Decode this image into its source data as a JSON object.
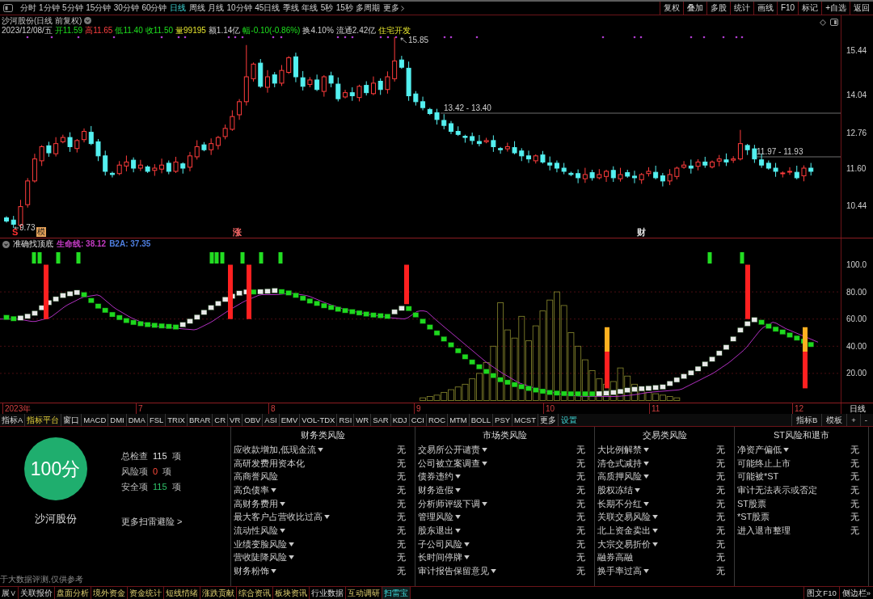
{
  "toolbar": {
    "periods": [
      {
        "label": "分时",
        "selected": false
      },
      {
        "label": "1分钟",
        "selected": false
      },
      {
        "label": "5分钟",
        "selected": false
      },
      {
        "label": "15分钟",
        "selected": false
      },
      {
        "label": "30分钟",
        "selected": false
      },
      {
        "label": "60分钟",
        "selected": false
      },
      {
        "label": "日线",
        "selected": true
      },
      {
        "label": "周线",
        "selected": false
      },
      {
        "label": "月线",
        "selected": false
      },
      {
        "label": "10分钟",
        "selected": false
      },
      {
        "label": "45日线",
        "selected": false
      },
      {
        "label": "季线",
        "selected": false
      },
      {
        "label": "年线",
        "selected": false
      },
      {
        "label": "5秒",
        "selected": false
      },
      {
        "label": "15秒",
        "selected": false
      },
      {
        "label": "多周期",
        "selected": false
      }
    ],
    "more": "更多",
    "actions": [
      "复权",
      "叠加",
      "多股",
      "统计",
      "画线",
      "F10",
      "标记",
      "+自选",
      "返回"
    ]
  },
  "stock_header": {
    "title": "沙河股份(日线 前复权)",
    "date": "2023/12/08/五",
    "quote": [
      {
        "text": "开11.59",
        "kind": "down"
      },
      {
        "text": "高11.65",
        "kind": "up"
      },
      {
        "text": "低11.40",
        "kind": "down"
      },
      {
        "text": "收11.50",
        "kind": "down"
      },
      {
        "text": "量99195",
        "kind": "volume"
      },
      {
        "text": "额1.14亿",
        "kind": "plain"
      },
      {
        "text": "幅-0.10(-0.86%)",
        "kind": "down"
      },
      {
        "text": "换4.10%",
        "kind": "plain"
      },
      {
        "text": "流通2.42亿",
        "kind": "plain"
      },
      {
        "text": "住宅开发",
        "kind": "sector"
      }
    ]
  },
  "price_chart": {
    "y_ticks": [
      "15.44",
      "14.04",
      "12.76",
      "11.60",
      "10.44"
    ],
    "high_label": "15.85",
    "low_label": "9.73",
    "price_lines": [
      {
        "label": "13.42 - 13.40"
      },
      {
        "label": "11.97 - 11.93"
      }
    ],
    "markers": [
      {
        "label": "S",
        "kind": "text",
        "color": "#ff3030"
      },
      {
        "label": "模",
        "kind": "tile",
        "color": "#e8a45a"
      },
      {
        "label": "涨",
        "kind": "text",
        "color": "#ff6a6a"
      },
      {
        "label": "财",
        "kind": "text",
        "color": "#e0e0e0"
      }
    ]
  },
  "indicator": {
    "name": "准确找顶底",
    "lines": [
      {
        "text": "生命线: 38.12",
        "color": "#c23bc2"
      },
      {
        "text": "B2A: 37.35",
        "color": "#4f7fe0"
      }
    ],
    "y_ticks": [
      "100.0",
      "80.00",
      "60.00",
      "40.00",
      "20.00"
    ]
  },
  "date_axis": {
    "labels": [
      "2023年",
      "7",
      "8",
      "9",
      "10",
      "11",
      "12"
    ],
    "period": "日线"
  },
  "indicator_tabs": {
    "items": [
      {
        "label": "指标A",
        "selected": false
      },
      {
        "label": "指标平台",
        "selected": true
      },
      {
        "label": "窗口",
        "selected": false
      },
      {
        "label": "MACD",
        "selected": false
      },
      {
        "label": "DMI",
        "selected": false
      },
      {
        "label": "DMA",
        "selected": false
      },
      {
        "label": "FSL",
        "selected": false
      },
      {
        "label": "TRIX",
        "selected": false
      },
      {
        "label": "BRAR",
        "selected": false
      },
      {
        "label": "CR",
        "selected": false
      },
      {
        "label": "VR",
        "selected": false
      },
      {
        "label": "OBV",
        "selected": false
      },
      {
        "label": "ASI",
        "selected": false
      },
      {
        "label": "EMV",
        "selected": false
      },
      {
        "label": "VOL-TDX",
        "selected": false
      },
      {
        "label": "RSI",
        "selected": false
      },
      {
        "label": "WR",
        "selected": false
      },
      {
        "label": "SAR",
        "selected": false
      },
      {
        "label": "KDJ",
        "selected": false
      },
      {
        "label": "CCI",
        "selected": false
      },
      {
        "label": "ROC",
        "selected": false
      },
      {
        "label": "MTM",
        "selected": false
      },
      {
        "label": "BOLL",
        "selected": false
      },
      {
        "label": "PSY",
        "selected": false
      },
      {
        "label": "MCST",
        "selected": false
      },
      {
        "label": "更多",
        "selected": false
      }
    ],
    "settings": "设置",
    "right": [
      "指标B",
      "模板",
      "+",
      "-"
    ]
  },
  "risk_scan": {
    "score": "100分",
    "stock": "沙河股份",
    "stats": [
      {
        "label": "总检查",
        "value": "115",
        "unit": "项",
        "kind": "total"
      },
      {
        "label": "风险项",
        "value": "0",
        "unit": "项",
        "kind": "risk"
      },
      {
        "label": "安全项",
        "value": "115",
        "unit": "项",
        "kind": "safe"
      }
    ],
    "more_link": "更多扫雷避险 >",
    "disclaimer": "于大数据评测,仅供参考",
    "categories": [
      {
        "title": "财务类风险",
        "items": [
          {
            "label": "应收款增加,低现金流",
            "dropdown": true,
            "result": "无"
          },
          {
            "label": "高研发费用资本化",
            "dropdown": false,
            "result": "无"
          },
          {
            "label": "高商誉风险",
            "dropdown": false,
            "result": "无"
          },
          {
            "label": "高负债率",
            "dropdown": true,
            "result": "无"
          },
          {
            "label": "高财务费用",
            "dropdown": true,
            "result": "无"
          },
          {
            "label": "最大客户占营收比过高",
            "dropdown": true,
            "result": "无"
          },
          {
            "label": "流动性风险",
            "dropdown": true,
            "result": "无"
          },
          {
            "label": "业绩变脸风险",
            "dropdown": true,
            "result": "无"
          },
          {
            "label": "营收陡降风险",
            "dropdown": true,
            "result": "无"
          },
          {
            "label": "财务粉饰",
            "dropdown": true,
            "result": "无"
          }
        ]
      },
      {
        "title": "市场类风险",
        "items": [
          {
            "label": "交易所公开谴责",
            "dropdown": true,
            "result": "无"
          },
          {
            "label": "公司被立案调查",
            "dropdown": true,
            "result": "无"
          },
          {
            "label": "债券违约",
            "dropdown": true,
            "result": "无"
          },
          {
            "label": "财务造假",
            "dropdown": true,
            "result": "无"
          },
          {
            "label": "分析师评级下调",
            "dropdown": true,
            "result": "无"
          },
          {
            "label": "管理风险",
            "dropdown": true,
            "result": "无"
          },
          {
            "label": "股东退出",
            "dropdown": true,
            "result": "无"
          },
          {
            "label": "子公司风险",
            "dropdown": true,
            "result": "无"
          },
          {
            "label": "长时间停牌",
            "dropdown": true,
            "result": "无"
          },
          {
            "label": "审计报告保留意见",
            "dropdown": true,
            "result": "无"
          }
        ]
      },
      {
        "title": "交易类风险",
        "items": [
          {
            "label": "大比例解禁",
            "dropdown": true,
            "result": "无"
          },
          {
            "label": "清仓式减持",
            "dropdown": true,
            "result": "无"
          },
          {
            "label": "高质押风险",
            "dropdown": true,
            "result": "无"
          },
          {
            "label": "股权冻结",
            "dropdown": true,
            "result": "无"
          },
          {
            "label": "长期不分红",
            "dropdown": true,
            "result": "无"
          },
          {
            "label": "关联交易风险",
            "dropdown": true,
            "result": "无"
          },
          {
            "label": "北上资金卖出",
            "dropdown": true,
            "result": "无"
          },
          {
            "label": "大宗交易折价",
            "dropdown": true,
            "result": "无"
          },
          {
            "label": "融券高融",
            "dropdown": false,
            "result": "无"
          },
          {
            "label": "换手率过高",
            "dropdown": true,
            "result": "无"
          }
        ]
      },
      {
        "title": "ST风险和退市",
        "items": [
          {
            "label": "净资产偏低",
            "dropdown": true,
            "result": "无"
          },
          {
            "label": "可能终止上市",
            "dropdown": false,
            "result": "无"
          },
          {
            "label": "可能被*ST",
            "dropdown": false,
            "result": "无"
          },
          {
            "label": "审计无法表示或否定",
            "dropdown": false,
            "result": "无"
          },
          {
            "label": "ST股票",
            "dropdown": false,
            "result": "无"
          },
          {
            "label": "*ST股票",
            "dropdown": false,
            "result": "无"
          },
          {
            "label": "进入退市整理",
            "dropdown": false,
            "result": "无"
          }
        ]
      }
    ]
  },
  "bottom_tabs": {
    "items": [
      {
        "label": "展∨",
        "selected": false,
        "highlighted": false
      },
      {
        "label": "关联报价",
        "selected": false,
        "highlighted": false
      },
      {
        "label": "盘面分析",
        "selected": false,
        "highlighted": true
      },
      {
        "label": "境外资金",
        "selected": false,
        "highlighted": true
      },
      {
        "label": "资金统计",
        "selected": false,
        "highlighted": true
      },
      {
        "label": "短线情绪",
        "selected": false,
        "highlighted": true
      },
      {
        "label": "涨跌贡献",
        "selected": false,
        "highlighted": true
      },
      {
        "label": "综合资讯",
        "selected": false,
        "highlighted": true
      },
      {
        "label": "板块资讯",
        "selected": false,
        "highlighted": true
      },
      {
        "label": "行业数据",
        "selected": false,
        "highlighted": false
      },
      {
        "label": "互动调研",
        "selected": false,
        "highlighted": true
      },
      {
        "label": "扫雷宝",
        "selected": true,
        "highlighted": false
      }
    ],
    "right": [
      "图文F10",
      "侧边栏»"
    ]
  }
}
